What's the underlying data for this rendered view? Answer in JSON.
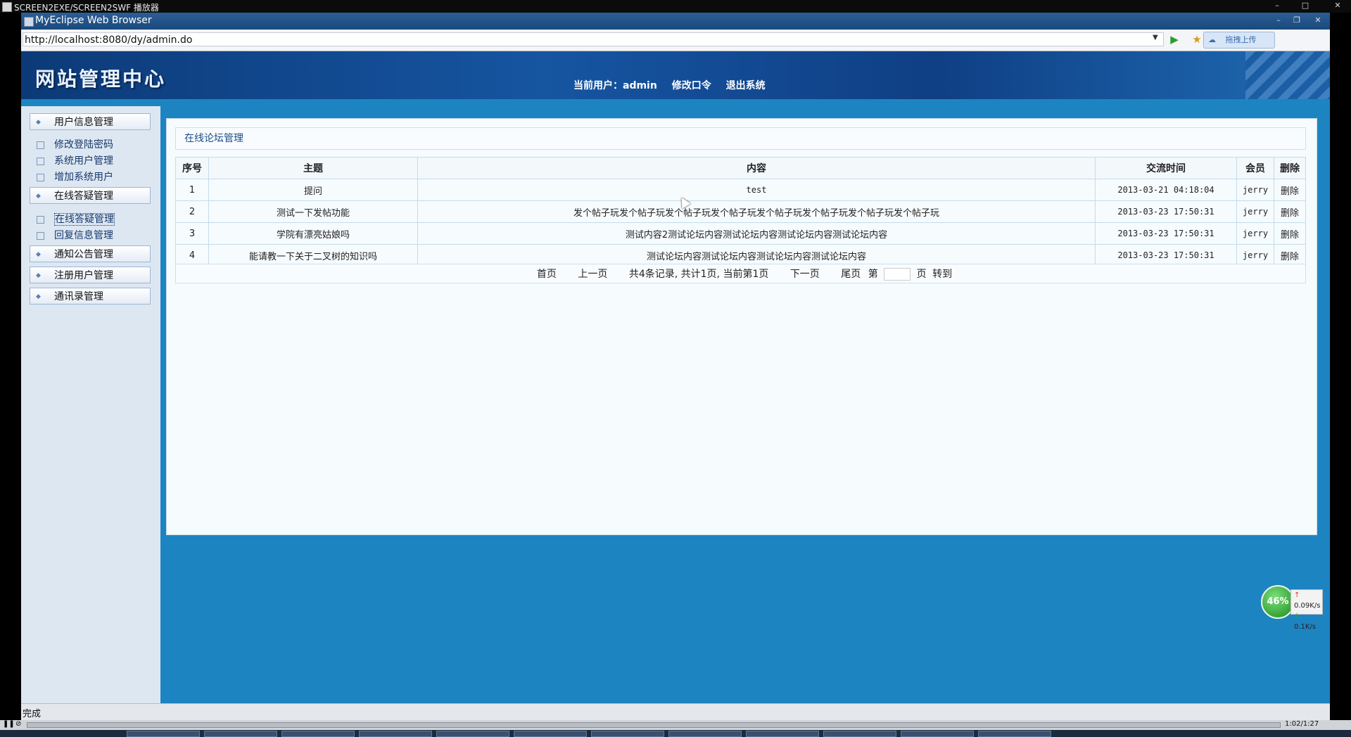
{
  "player": {
    "title": "SCREEN2EXE/SCREEN2SWF 播放器",
    "time": "1:02/1:27"
  },
  "browser": {
    "title": "MyEclipse Web Browser",
    "url": "http://localhost:8080/dy/admin.do",
    "upload_label": "拖拽上传",
    "status": "完成"
  },
  "header": {
    "site_title": "网站管理中心",
    "current_user_label": "当前用户：admin",
    "change_password": "修改口令",
    "logout": "退出系统"
  },
  "sidebar": {
    "groups": [
      {
        "label": "用户信息管理",
        "items": [
          "修改登陆密码",
          "系统用户管理",
          "增加系统用户"
        ]
      },
      {
        "label": "在线答疑管理",
        "items": [
          "在线答疑管理",
          "回复信息管理"
        ]
      },
      {
        "label": "通知公告管理",
        "items": []
      },
      {
        "label": "注册用户管理",
        "items": []
      },
      {
        "label": "通讯录管理",
        "items": []
      }
    ]
  },
  "panel": {
    "title": "在线论坛管理"
  },
  "table": {
    "headers": [
      "序号",
      "主题",
      "内容",
      "交流时间",
      "会员",
      "删除"
    ],
    "rows": [
      [
        "1",
        "提问",
        "test",
        "2013-03-21 04:18:04",
        "jerry",
        "删除"
      ],
      [
        "2",
        "测试一下发帖功能",
        "发个帖子玩发个帖子玩发个帖子玩发个帖子玩发个帖子玩发个帖子玩发个帖子玩发个帖子玩",
        "2013-03-23 17:50:31",
        "jerry",
        "删除"
      ],
      [
        "3",
        "学院有漂亮姑娘吗",
        "测试内容2测试论坛内容测试论坛内容测试论坛内容测试论坛内容",
        "2013-03-23 17:50:31",
        "jerry",
        "删除"
      ],
      [
        "4",
        "能请教一下关于二叉树的知识吗",
        "测试论坛内容测试论坛内容测试论坛内容测试论坛内容",
        "2013-03-23 17:50:31",
        "jerry",
        "删除"
      ]
    ]
  },
  "pager": {
    "first": "首页",
    "prev": "上一页",
    "summary": "共4条记录, 共计1页, 当前第1页",
    "next": "下一页",
    "last": "尾页",
    "page_prefix": "第",
    "page_suffix": "页",
    "goto": "转到"
  },
  "net_widget": {
    "percent": "46%",
    "up": "0.09K/s",
    "down": "0.1K/s"
  }
}
